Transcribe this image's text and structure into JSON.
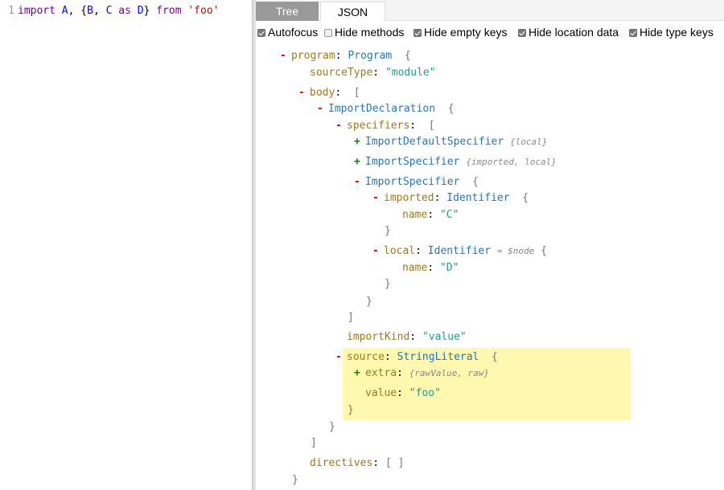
{
  "editor": {
    "line_number": "1",
    "tokens": {
      "import": "import",
      "a": "A",
      "comma": ",",
      "open": "{",
      "b": "B",
      "comma2": ",",
      "c": "C",
      "as": "as",
      "d": "D",
      "close": "}",
      "from": "from",
      "src": "'foo'"
    }
  },
  "tabs": {
    "tree": "Tree",
    "json": "JSON"
  },
  "options": {
    "autofocus": "Autofocus",
    "hide_methods": "Hide methods",
    "hide_empty_keys": "Hide empty keys",
    "hide_location_data": "Hide location data",
    "hide_type_keys": "Hide type keys",
    "checked": {
      "autofocus": true,
      "hide_methods": false,
      "hide_empty_keys": true,
      "hide_location_data": true,
      "hide_type_keys": true
    }
  },
  "tree": {
    "program_key": "program",
    "program_type": "Program",
    "sourceType_key": "sourceType",
    "sourceType_val": "\"module\"",
    "body_key": "body",
    "import_decl": "ImportDeclaration",
    "specifiers_key": "specifiers",
    "spec1": "ImportDefaultSpecifier",
    "spec1_summary": "{local}",
    "spec2": "ImportSpecifier",
    "spec2_summary": "{imported, local}",
    "spec3": "ImportSpecifier",
    "imported_key": "imported",
    "identifier": "Identifier",
    "name_key": "name",
    "name_c": "\"C\"",
    "local_key": "local",
    "node_ref": "= $node",
    "name_d": "\"D\"",
    "importKind_key": "importKind",
    "importKind_val": "\"value\"",
    "source_key": "source",
    "string_literal": "StringLiteral",
    "extra_key": "extra",
    "extra_summary": "{rawValue, raw}",
    "value_key": "value",
    "value_val": "\"foo\"",
    "directives_key": "directives",
    "empty_array": "[ ]",
    "open_brace": "{",
    "close_brace": "}",
    "open_bracket": "[",
    "close_bracket": "]",
    "minus": "-",
    "plus": "+",
    "colon": ":"
  },
  "colors": {
    "key": "#a0791b",
    "type": "#2775b8",
    "string": "#1f9c8b",
    "highlight": "#fff9b0",
    "minus": "#e00000",
    "plus": "#008000"
  }
}
